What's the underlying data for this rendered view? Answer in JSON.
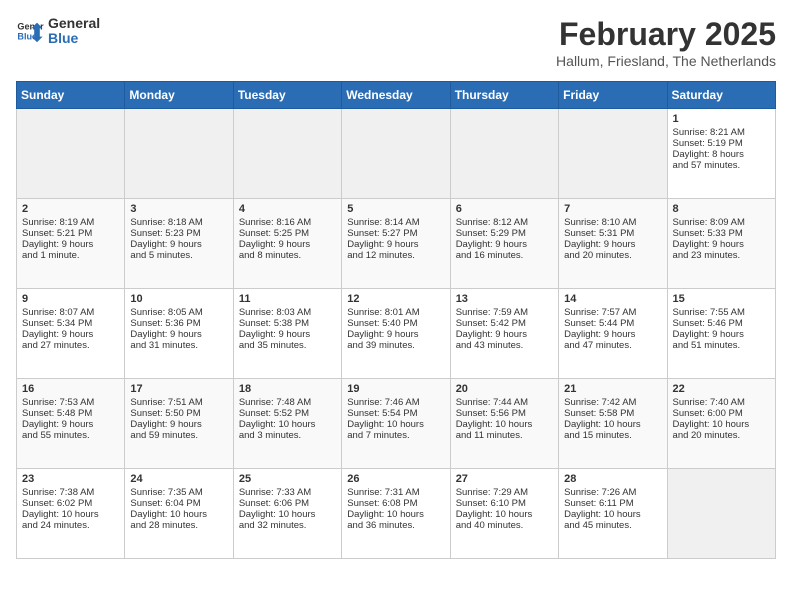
{
  "header": {
    "logo_line1": "General",
    "logo_line2": "Blue",
    "month_title": "February 2025",
    "subtitle": "Hallum, Friesland, The Netherlands"
  },
  "days_of_week": [
    "Sunday",
    "Monday",
    "Tuesday",
    "Wednesday",
    "Thursday",
    "Friday",
    "Saturday"
  ],
  "weeks": [
    [
      {
        "day": "",
        "content": ""
      },
      {
        "day": "",
        "content": ""
      },
      {
        "day": "",
        "content": ""
      },
      {
        "day": "",
        "content": ""
      },
      {
        "day": "",
        "content": ""
      },
      {
        "day": "",
        "content": ""
      },
      {
        "day": "1",
        "content": "Sunrise: 8:21 AM\nSunset: 5:19 PM\nDaylight: 8 hours\nand 57 minutes."
      }
    ],
    [
      {
        "day": "2",
        "content": "Sunrise: 8:19 AM\nSunset: 5:21 PM\nDaylight: 9 hours\nand 1 minute."
      },
      {
        "day": "3",
        "content": "Sunrise: 8:18 AM\nSunset: 5:23 PM\nDaylight: 9 hours\nand 5 minutes."
      },
      {
        "day": "4",
        "content": "Sunrise: 8:16 AM\nSunset: 5:25 PM\nDaylight: 9 hours\nand 8 minutes."
      },
      {
        "day": "5",
        "content": "Sunrise: 8:14 AM\nSunset: 5:27 PM\nDaylight: 9 hours\nand 12 minutes."
      },
      {
        "day": "6",
        "content": "Sunrise: 8:12 AM\nSunset: 5:29 PM\nDaylight: 9 hours\nand 16 minutes."
      },
      {
        "day": "7",
        "content": "Sunrise: 8:10 AM\nSunset: 5:31 PM\nDaylight: 9 hours\nand 20 minutes."
      },
      {
        "day": "8",
        "content": "Sunrise: 8:09 AM\nSunset: 5:33 PM\nDaylight: 9 hours\nand 23 minutes."
      }
    ],
    [
      {
        "day": "9",
        "content": "Sunrise: 8:07 AM\nSunset: 5:34 PM\nDaylight: 9 hours\nand 27 minutes."
      },
      {
        "day": "10",
        "content": "Sunrise: 8:05 AM\nSunset: 5:36 PM\nDaylight: 9 hours\nand 31 minutes."
      },
      {
        "day": "11",
        "content": "Sunrise: 8:03 AM\nSunset: 5:38 PM\nDaylight: 9 hours\nand 35 minutes."
      },
      {
        "day": "12",
        "content": "Sunrise: 8:01 AM\nSunset: 5:40 PM\nDaylight: 9 hours\nand 39 minutes."
      },
      {
        "day": "13",
        "content": "Sunrise: 7:59 AM\nSunset: 5:42 PM\nDaylight: 9 hours\nand 43 minutes."
      },
      {
        "day": "14",
        "content": "Sunrise: 7:57 AM\nSunset: 5:44 PM\nDaylight: 9 hours\nand 47 minutes."
      },
      {
        "day": "15",
        "content": "Sunrise: 7:55 AM\nSunset: 5:46 PM\nDaylight: 9 hours\nand 51 minutes."
      }
    ],
    [
      {
        "day": "16",
        "content": "Sunrise: 7:53 AM\nSunset: 5:48 PM\nDaylight: 9 hours\nand 55 minutes."
      },
      {
        "day": "17",
        "content": "Sunrise: 7:51 AM\nSunset: 5:50 PM\nDaylight: 9 hours\nand 59 minutes."
      },
      {
        "day": "18",
        "content": "Sunrise: 7:48 AM\nSunset: 5:52 PM\nDaylight: 10 hours\nand 3 minutes."
      },
      {
        "day": "19",
        "content": "Sunrise: 7:46 AM\nSunset: 5:54 PM\nDaylight: 10 hours\nand 7 minutes."
      },
      {
        "day": "20",
        "content": "Sunrise: 7:44 AM\nSunset: 5:56 PM\nDaylight: 10 hours\nand 11 minutes."
      },
      {
        "day": "21",
        "content": "Sunrise: 7:42 AM\nSunset: 5:58 PM\nDaylight: 10 hours\nand 15 minutes."
      },
      {
        "day": "22",
        "content": "Sunrise: 7:40 AM\nSunset: 6:00 PM\nDaylight: 10 hours\nand 20 minutes."
      }
    ],
    [
      {
        "day": "23",
        "content": "Sunrise: 7:38 AM\nSunset: 6:02 PM\nDaylight: 10 hours\nand 24 minutes."
      },
      {
        "day": "24",
        "content": "Sunrise: 7:35 AM\nSunset: 6:04 PM\nDaylight: 10 hours\nand 28 minutes."
      },
      {
        "day": "25",
        "content": "Sunrise: 7:33 AM\nSunset: 6:06 PM\nDaylight: 10 hours\nand 32 minutes."
      },
      {
        "day": "26",
        "content": "Sunrise: 7:31 AM\nSunset: 6:08 PM\nDaylight: 10 hours\nand 36 minutes."
      },
      {
        "day": "27",
        "content": "Sunrise: 7:29 AM\nSunset: 6:10 PM\nDaylight: 10 hours\nand 40 minutes."
      },
      {
        "day": "28",
        "content": "Sunrise: 7:26 AM\nSunset: 6:11 PM\nDaylight: 10 hours\nand 45 minutes."
      },
      {
        "day": "",
        "content": ""
      }
    ]
  ]
}
